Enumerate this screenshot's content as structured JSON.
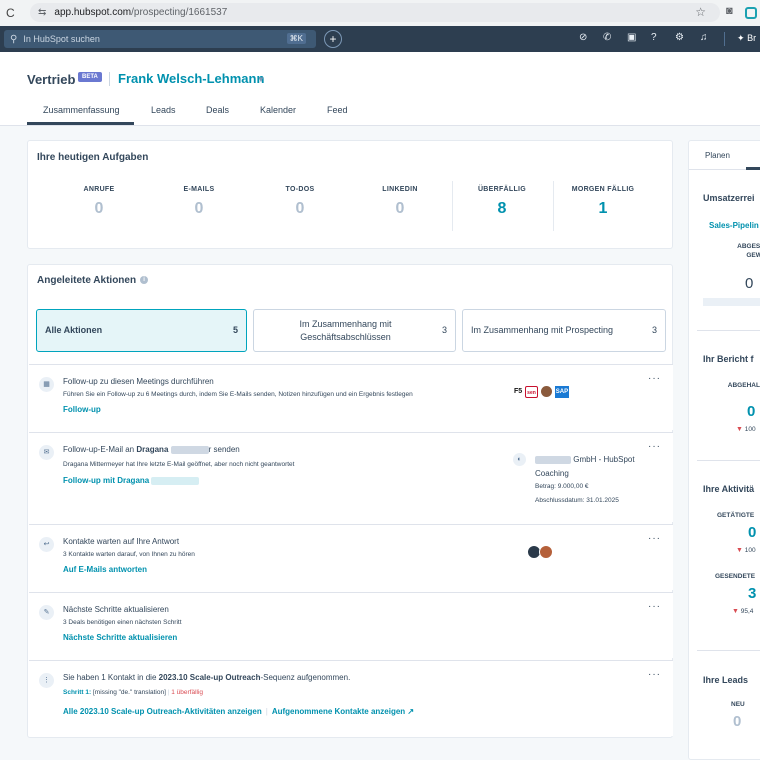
{
  "browser": {
    "url_host": "app.hubspot.com",
    "url_path": "/prospecting/1661537"
  },
  "nav": {
    "search_placeholder": "In HubSpot suchen",
    "search_shortcut": "⌘K",
    "profile_text": "Br"
  },
  "header": {
    "title": "Vertrieb",
    "badge": "BETA",
    "owner": "Frank Welsch-Lehmann",
    "tabs": [
      "Zusammenfassung",
      "Leads",
      "Deals",
      "Kalender",
      "Feed"
    ]
  },
  "tasks": {
    "title": "Ihre heutigen Aufgaben",
    "metrics": [
      {
        "label": "ANRUFE",
        "value": "0"
      },
      {
        "label": "E-MAILS",
        "value": "0"
      },
      {
        "label": "TO-DOS",
        "value": "0"
      },
      {
        "label": "LINKEDIN",
        "value": "0"
      },
      {
        "label": "ÜBERFÄLLIG",
        "value": "8"
      },
      {
        "label": "MORGEN FÄLLIG",
        "value": "1"
      }
    ]
  },
  "actions": {
    "title": "Angeleitete Aktionen",
    "filters": [
      {
        "label": "Alle Aktionen",
        "count": "5"
      },
      {
        "label": "Im Zusammenhang mit Geschäftsabschlüssen",
        "count": "3"
      },
      {
        "label": "Im Zusammenhang mit Prospecting",
        "count": "3"
      }
    ],
    "items": [
      {
        "title": "Follow-up zu diesen Meetings durchführen",
        "sub": "Führen Sie ein Follow-up zu 6 Meetings durch, indem Sie E-Mails senden, Notizen hinzufügen und ein Ergebnis festlegen",
        "link": "Follow-up",
        "logos": [
          "F5",
          "sen",
          "SAP"
        ]
      },
      {
        "title_pre": "Follow-up-E-Mail an",
        "title_name": "Dragana",
        "title_post": "r senden",
        "sub": "Dragana Mittermeyer hat Ihre letzte E-Mail geöffnet, aber noch nicht geantwortet",
        "link": "Follow-up mit Dragana",
        "deal_name": "GmbH - HubSpot Coaching",
        "deal_amount": "Betrag: 9.000,00 €",
        "deal_date": "Abschlussdatum: 31.01.2025"
      },
      {
        "title": "Kontakte warten auf Ihre Antwort",
        "sub": "3 Kontakte warten darauf, von Ihnen zu hören",
        "link": "Auf E-Mails antworten"
      },
      {
        "title": "Nächste Schritte aktualisieren",
        "sub": "3 Deals benötigen einen nächsten Schritt",
        "link": "Nächste Schritte aktualisieren"
      },
      {
        "title_pre": "Sie haben 1 Kontakt in die",
        "title_seq": "2023.10 Scale-up Outreach",
        "title_post": "-Sequenz aufgenommen.",
        "step_label": "Schritt 1:",
        "step_text": "[missing \"de.\" translation]",
        "step_overdue": "1 überfällig",
        "link1": "Alle 2023.10 Scale-up Outreach-Aktivitäten anzeigen",
        "link2": "Aufgenommene Kontakte anzeigen"
      }
    ]
  },
  "right_panel": {
    "tab": "Planen",
    "sections": [
      {
        "title": "Umsatzerrei",
        "link": "Sales-Pipelin",
        "label": "ABGESCH UN GEWON",
        "value": "0"
      },
      {
        "title": "Ihr Bericht f",
        "label": "ABGEHAL MEETIN",
        "value": "0",
        "delta": "100"
      },
      {
        "title": "Ihre Aktivitä",
        "label": "GETÄTIGTE",
        "value": "0",
        "delta": "100",
        "label2": "GESENDETE",
        "value2": "3",
        "delta2": "95,4"
      },
      {
        "title": "Ihre Leads",
        "label": "NEU",
        "value": "0"
      }
    ]
  },
  "colors": {
    "accent": "#0091ae",
    "nav": "#2d3e50",
    "overdue": "#d94c53"
  }
}
